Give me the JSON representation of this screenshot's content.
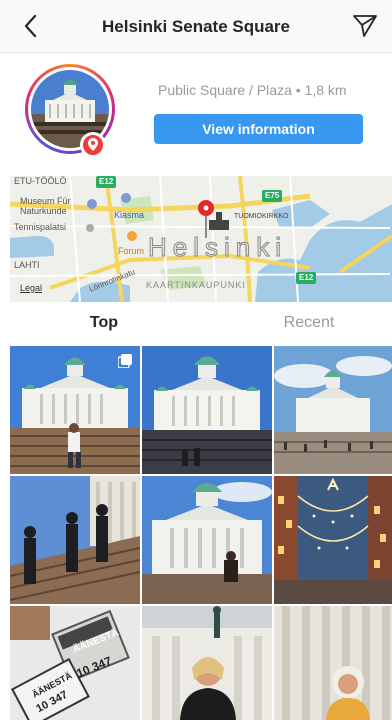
{
  "header": {
    "back_icon": "chevron-left-icon",
    "title": "Helsinki Senate Square",
    "share_icon": "paper-plane-icon"
  },
  "profile": {
    "avatar_icon": "location-pin-icon",
    "category": "Public Square / Plaza",
    "separator": " • ",
    "distance": "1,8 km",
    "view_button": "View information"
  },
  "map": {
    "labels": {
      "etu_toolo": "ETU-TÖÖLÖ",
      "museum": "Museum Für Naturkunde",
      "tennispalatsi": "Tennispalatsi",
      "kiasma": "Kiasma",
      "forum": "Forum",
      "tuomiokirkko": "TUOMIOKIRKKO",
      "lahti": "LAHTI",
      "lonnrotinkatu": "Lönnrotinkatu",
      "city": "Helsinki",
      "kaartinkaupunki": "KAARTINKAUPUNKI",
      "legal": "Legal"
    },
    "road_shields": [
      "E12",
      "E75",
      "E12"
    ],
    "colors": {
      "water": "#a3cbe8",
      "land": "#eef0e9",
      "road": "#f6d55c",
      "park": "#cde5b8",
      "pin": "#e3262b"
    }
  },
  "tabs": {
    "top": "Top",
    "recent": "Recent"
  },
  "grid": {
    "posts": [
      {
        "name": "post-1",
        "multi": true
      },
      {
        "name": "post-2",
        "multi": false
      },
      {
        "name": "post-3",
        "multi": false
      },
      {
        "name": "post-4",
        "multi": false
      },
      {
        "name": "post-5",
        "multi": false
      },
      {
        "name": "post-6",
        "multi": false
      },
      {
        "name": "post-7",
        "multi": false,
        "text": [
          "ÄÄNESTÄ",
          "ÄÄNESTÄ",
          "10 347",
          "10 347"
        ]
      },
      {
        "name": "post-8",
        "multi": false
      },
      {
        "name": "post-9",
        "multi": false
      }
    ]
  },
  "colors": {
    "accent": "#3897f0",
    "pin_badge": "#ef3b3b"
  }
}
